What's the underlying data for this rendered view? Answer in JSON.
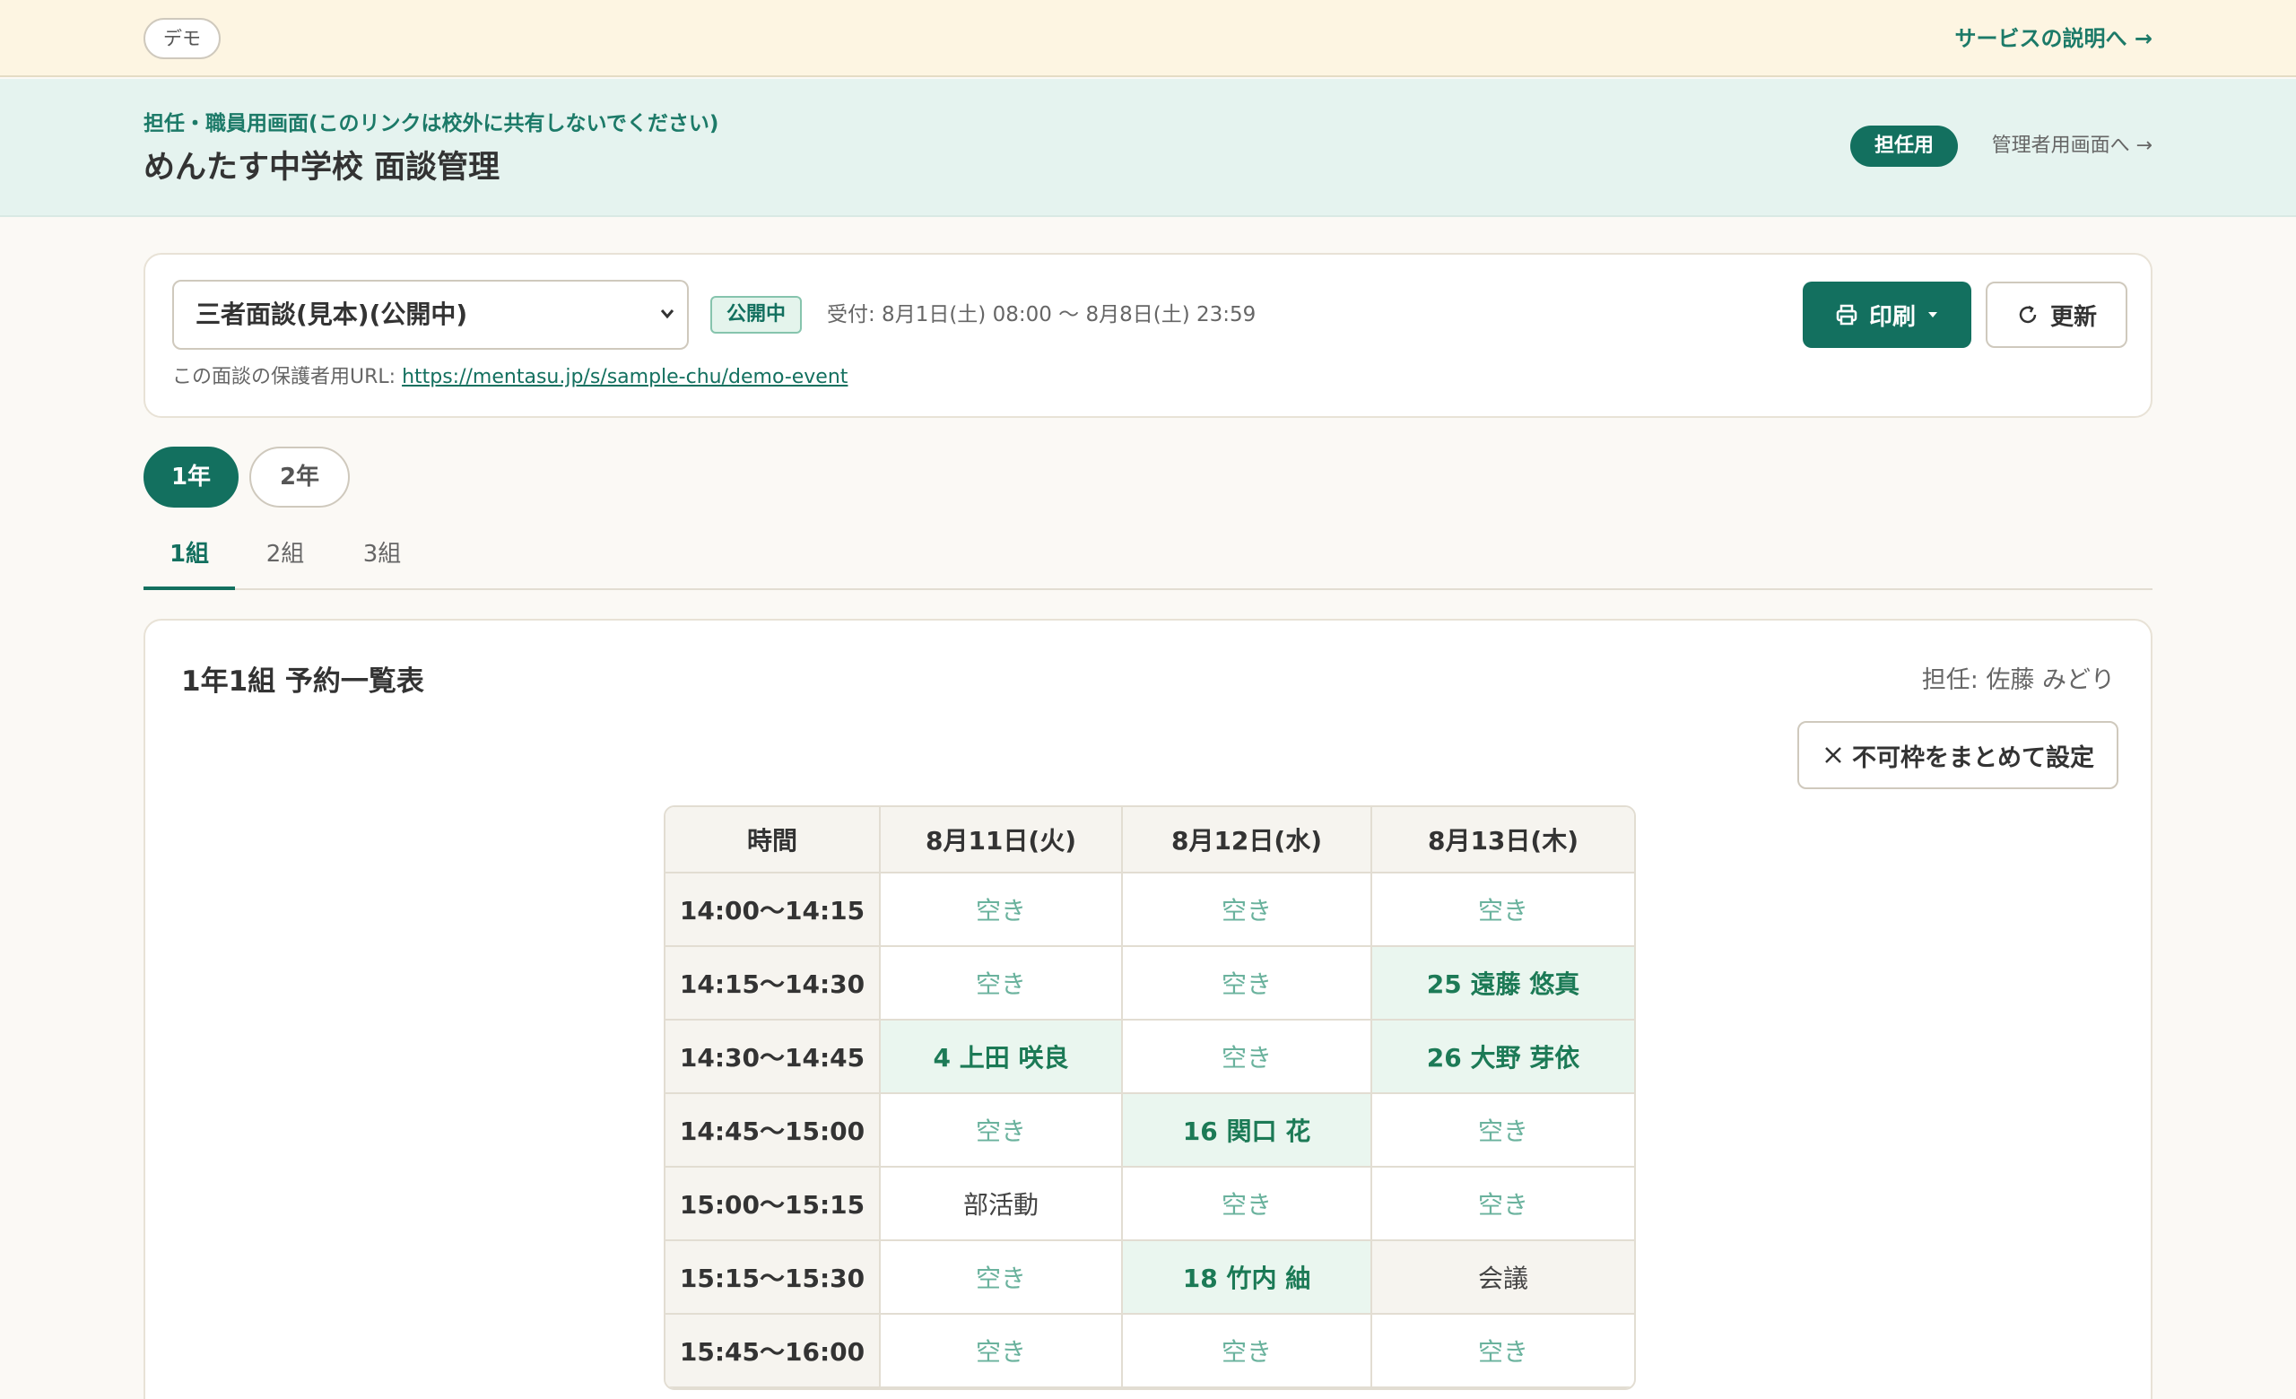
{
  "demo_bar": {
    "badge": "デモ",
    "service_link": "サービスの説明へ →"
  },
  "header": {
    "subtitle": "担任・職員用画面(このリンクは校外に共有しないでください)",
    "title": "めんたす中学校 面談管理",
    "role_badge": "担任用",
    "admin_link": "管理者用画面へ →"
  },
  "event": {
    "selected": "三者面談(見本)(公開中)",
    "status": "公開中",
    "reception": "受付: 8月1日(土) 08:00 〜 8月8日(土) 23:59",
    "print_label": "印刷",
    "refresh_label": "更新",
    "parent_url_label": "この面談の保護者用URL: ",
    "parent_url": "https://mentasu.jp/s/sample-chu/demo-event"
  },
  "grades": [
    "1年",
    "2年"
  ],
  "classes": [
    "1組",
    "2組",
    "3組"
  ],
  "card": {
    "title": "1年1組 予約一覧表",
    "teacher": "担任: 佐藤 みどり",
    "unavailable_button": "不可枠をまとめて設定"
  },
  "schedule": {
    "headers": [
      "時間",
      "8月11日(火)",
      "8月12日(水)",
      "8月13日(木)"
    ],
    "rows": [
      {
        "time": "14:00〜14:15",
        "cells": [
          {
            "text": "空き",
            "type": "empty"
          },
          {
            "text": "空き",
            "type": "empty"
          },
          {
            "text": "空き",
            "type": "empty"
          }
        ]
      },
      {
        "time": "14:15〜14:30",
        "cells": [
          {
            "text": "空き",
            "type": "empty"
          },
          {
            "text": "空き",
            "type": "empty"
          },
          {
            "text": "25 遠藤 悠真",
            "type": "booked"
          }
        ]
      },
      {
        "time": "14:30〜14:45",
        "cells": [
          {
            "text": "4 上田 咲良",
            "type": "booked"
          },
          {
            "text": "空き",
            "type": "empty"
          },
          {
            "text": "26 大野 芽依",
            "type": "booked"
          }
        ]
      },
      {
        "time": "14:45〜15:00",
        "cells": [
          {
            "text": "空き",
            "type": "empty"
          },
          {
            "text": "16 関口 花",
            "type": "booked"
          },
          {
            "text": "空き",
            "type": "empty"
          }
        ]
      },
      {
        "time": "15:00〜15:15",
        "cells": [
          {
            "text": "部活動",
            "type": "plain-blocked"
          },
          {
            "text": "空き",
            "type": "empty"
          },
          {
            "text": "空き",
            "type": "empty"
          }
        ]
      },
      {
        "time": "15:15〜15:30",
        "cells": [
          {
            "text": "空き",
            "type": "empty"
          },
          {
            "text": "18 竹内 紬",
            "type": "booked"
          },
          {
            "text": "会議",
            "type": "blocked"
          }
        ]
      },
      {
        "time": "15:45〜16:00",
        "cells": [
          {
            "text": "空き",
            "type": "empty"
          },
          {
            "text": "空き",
            "type": "empty"
          },
          {
            "text": "空き",
            "type": "empty"
          }
        ]
      }
    ]
  },
  "colors": {
    "brand": "#13705f",
    "header_bg": "#e5f3ef",
    "demo_bg": "#fdf5e2",
    "booked_bg": "#eaf6ef"
  }
}
